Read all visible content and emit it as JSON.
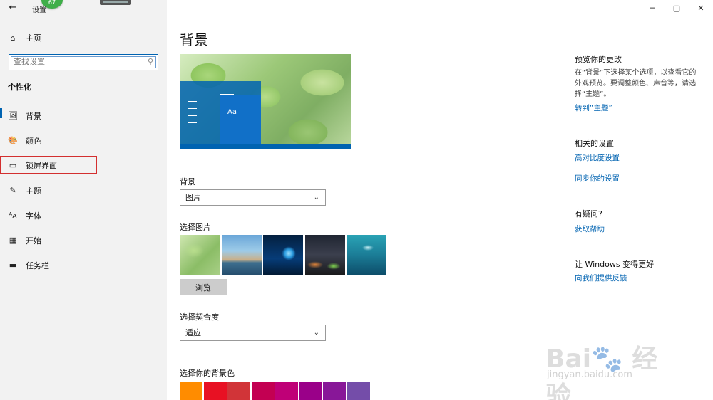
{
  "window": {
    "title": "设置",
    "notification_count": "67",
    "controls": {
      "minimize": "─",
      "maximize": "▢",
      "close": "✕"
    }
  },
  "sidebar": {
    "back_icon": "back-arrow-icon",
    "home_label": "主页",
    "search_placeholder": "查找设置",
    "section_heading": "个性化",
    "items": [
      {
        "label": "背景",
        "icon": "picture-icon",
        "active": true
      },
      {
        "label": "颜色",
        "icon": "palette-icon"
      },
      {
        "label": "锁屏界面",
        "icon": "lock-screen-icon",
        "highlighted": true
      },
      {
        "label": "主题",
        "icon": "theme-brush-icon"
      },
      {
        "label": "字体",
        "icon": "font-icon"
      },
      {
        "label": "开始",
        "icon": "start-grid-icon"
      },
      {
        "label": "任务栏",
        "icon": "taskbar-icon"
      }
    ]
  },
  "main": {
    "page_title": "背景",
    "preview_sample_text": "Aa",
    "background_label": "背景",
    "background_value": "图片",
    "choose_picture_label": "选择图片",
    "browse_label": "浏览",
    "fit_label": "选择契合度",
    "fit_value": "适应",
    "bg_color_label": "选择你的背景色",
    "swatch_colors": [
      "#ff8c00",
      "#e81123",
      "#d13438",
      "#c30052",
      "#bf0077",
      "#9a0089",
      "#881798",
      "#744da9"
    ]
  },
  "right_panel": {
    "preview_heading": "预览你的更改",
    "preview_text": "在“背景”下选择某个选项，以查看它的外观预览。要调整颜色、声音等，请选择“主题”。",
    "goto_theme_link": "转到“主题”",
    "related_heading": "相关的设置",
    "high_contrast_link": "高对比度设置",
    "sync_link": "同步你的设置",
    "question_heading": "有疑问?",
    "help_link": "获取帮助",
    "better_heading": "让 Windows 变得更好",
    "feedback_link": "向我们提供反馈"
  },
  "watermark": {
    "brand": "Bai🐾 经验",
    "url": "jingyan.baidu.com"
  }
}
